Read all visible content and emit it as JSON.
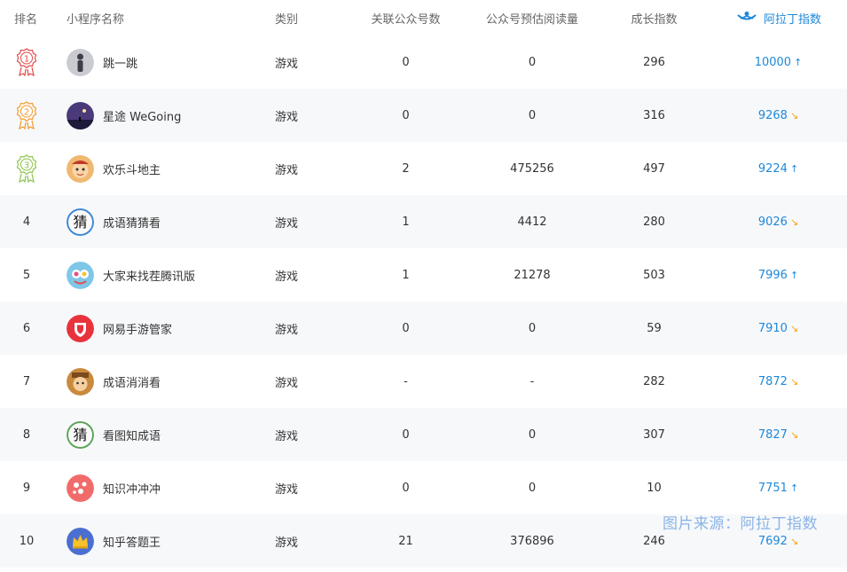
{
  "header": {
    "rank": "排名",
    "name": "小程序名称",
    "category": "类别",
    "related": "关联公众号数",
    "reads": "公众号预估阅读量",
    "growth": "成长指数",
    "index": "阿拉丁指数",
    "index_icon": "crown-logo-icon"
  },
  "rows": [
    {
      "rank": "1",
      "name": "跳一跳",
      "category": "游戏",
      "related": "0",
      "reads": "0",
      "growth": "296",
      "index": "10000",
      "trend": "up",
      "medal_color": "#e34848",
      "avatar_color": "#c9cbd1",
      "avatar_icon": "person-figure-icon"
    },
    {
      "rank": "2",
      "name": "星途 WeGoing",
      "category": "游戏",
      "related": "0",
      "reads": "0",
      "growth": "316",
      "index": "9268",
      "trend": "down",
      "medal_color": "#f39a2a",
      "avatar_color": "#4a3a7a",
      "avatar_icon": "night-sky-icon"
    },
    {
      "rank": "3",
      "name": "欢乐斗地主",
      "category": "游戏",
      "related": "2",
      "reads": "475256",
      "growth": "497",
      "index": "9224",
      "trend": "up",
      "medal_color": "#8bc34a",
      "avatar_color": "#f0b870",
      "avatar_icon": "cartoon-face-icon"
    },
    {
      "rank": "4",
      "name": "成语猜猜看",
      "category": "游戏",
      "related": "1",
      "reads": "4412",
      "growth": "280",
      "index": "9026",
      "trend": "down",
      "avatar_color": "#3d86d6",
      "avatar_icon": "guess-char-icon"
    },
    {
      "rank": "5",
      "name": "大家来找茬腾讯版",
      "category": "游戏",
      "related": "1",
      "reads": "21278",
      "growth": "503",
      "index": "7996",
      "trend": "up",
      "avatar_color": "#7fc7e8",
      "avatar_icon": "colorful-game-icon"
    },
    {
      "rank": "6",
      "name": "网易手游管家",
      "category": "游戏",
      "related": "0",
      "reads": "0",
      "growth": "59",
      "index": "7910",
      "trend": "down",
      "avatar_color": "#e8333c",
      "avatar_icon": "shield-icon"
    },
    {
      "rank": "7",
      "name": "成语消消看",
      "category": "游戏",
      "related": "-",
      "reads": "-",
      "growth": "282",
      "index": "7872",
      "trend": "down",
      "avatar_color": "#c98a3d",
      "avatar_icon": "character-face-icon"
    },
    {
      "rank": "8",
      "name": "看图知成语",
      "category": "游戏",
      "related": "0",
      "reads": "0",
      "growth": "307",
      "index": "7827",
      "trend": "down",
      "avatar_color": "#5aa35a",
      "avatar_icon": "guess-char-icon"
    },
    {
      "rank": "9",
      "name": "知识冲冲冲",
      "category": "游戏",
      "related": "0",
      "reads": "0",
      "growth": "10",
      "index": "7751",
      "trend": "up",
      "avatar_color": "#f26b6b",
      "avatar_icon": "mushroom-icon"
    },
    {
      "rank": "10",
      "name": "知乎答题王",
      "category": "游戏",
      "related": "21",
      "reads": "376896",
      "growth": "246",
      "index": "7692",
      "trend": "down",
      "avatar_color": "#4a6fd0",
      "avatar_icon": "crown-icon"
    }
  ],
  "watermark": "图片来源：阿拉丁指数",
  "colors": {
    "accent": "#1e88d8",
    "up": "#1e88d8",
    "down": "#f3a21c",
    "alt_row": "#f7f8fa"
  }
}
